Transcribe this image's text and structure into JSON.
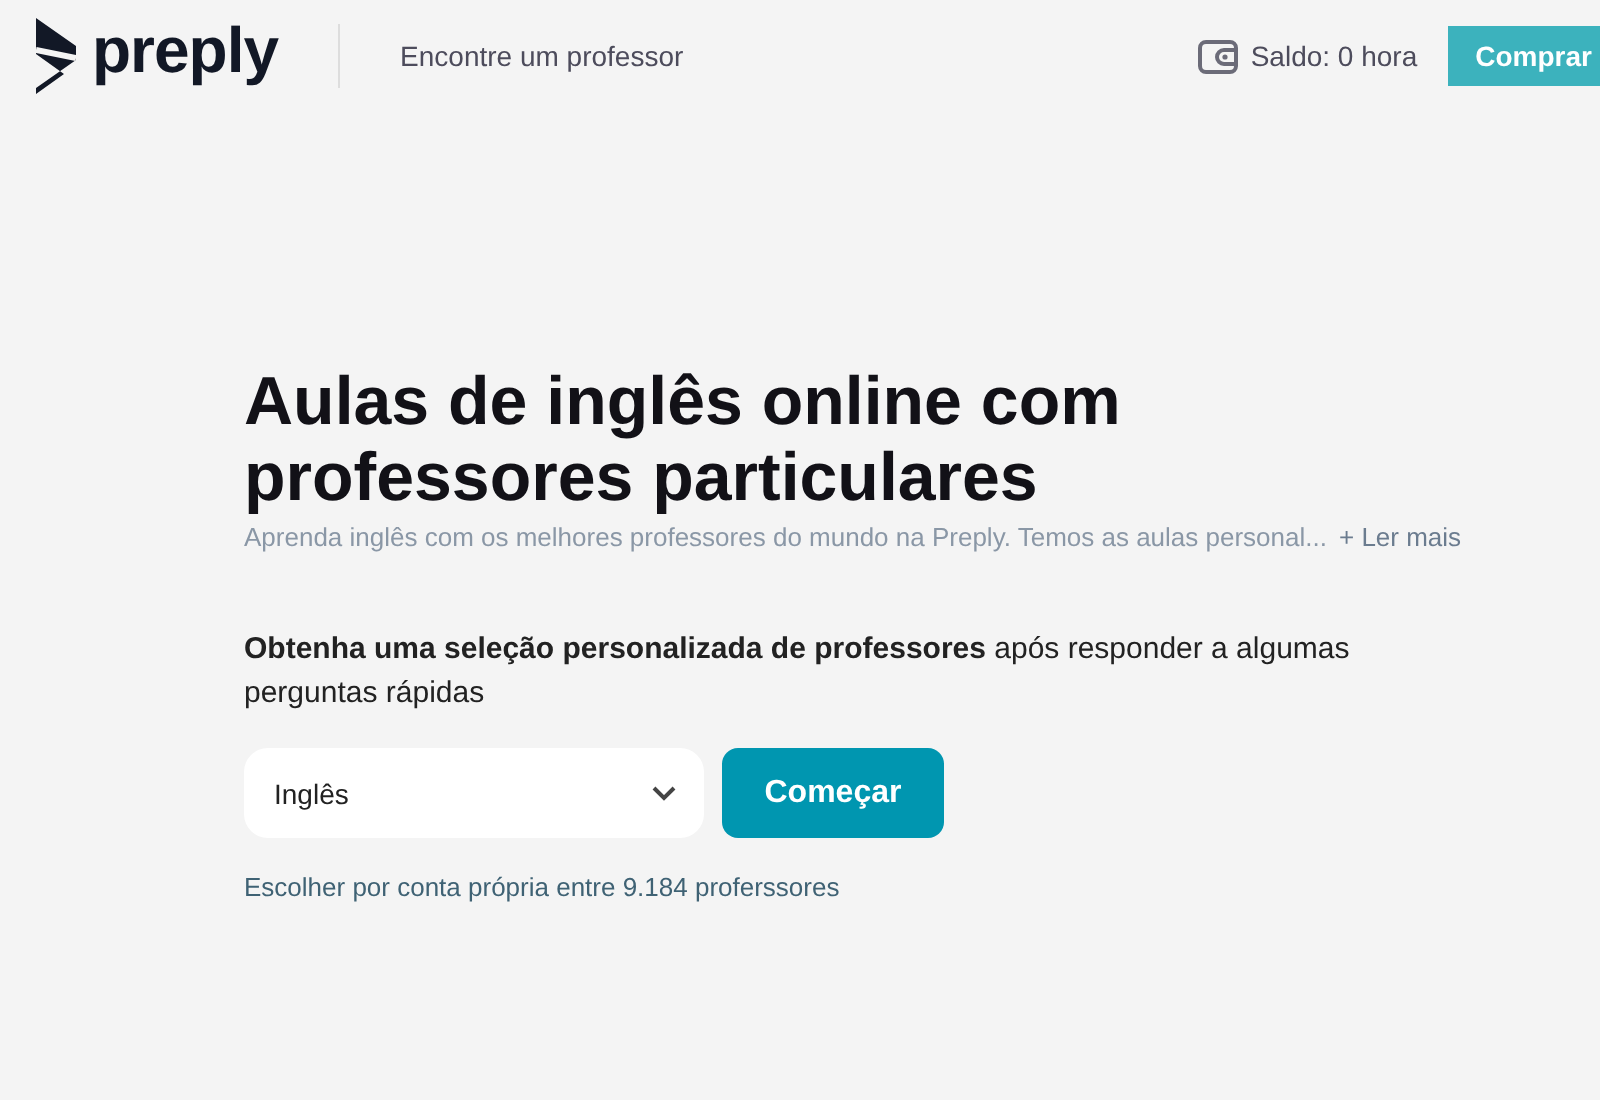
{
  "header": {
    "logo": "preply",
    "nav_link": "Encontre um professor",
    "balance": "Saldo: 0 hora",
    "buy_button": "Comprar"
  },
  "hero": {
    "title": "Aulas de inglês online com professores particulares",
    "subtitle": "Aprenda inglês com os melhores professores do mundo na Preply. Temos as aulas personal...",
    "read_more": "+ Ler mais",
    "prompt": "**Obtenha uma seleção personalizada de professores** após responder a algumas perguntas rápidas",
    "language_select": {
      "value": "Inglês"
    },
    "start_button": "Começar",
    "browse_link": "Escolher por conta própria entre 9.184 proferssores"
  }
}
